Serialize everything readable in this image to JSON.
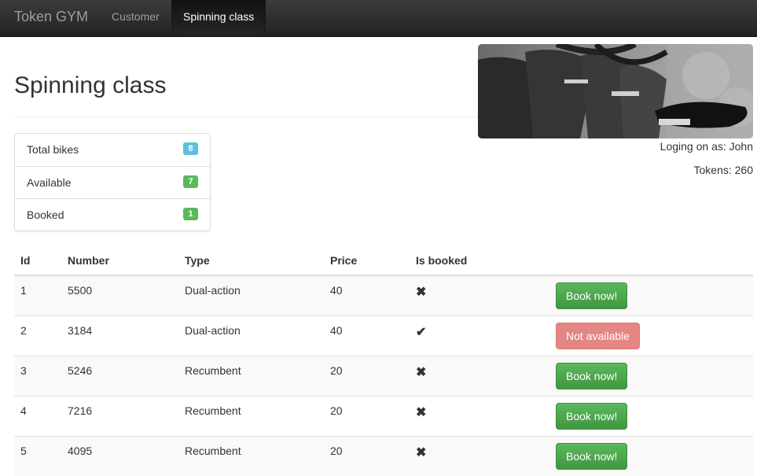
{
  "navbar": {
    "brand": "Token GYM",
    "items": [
      {
        "label": "Customer"
      },
      {
        "label": "Spinning class"
      }
    ]
  },
  "page": {
    "title": "Spinning class",
    "user_text": "Loging on as: John",
    "tokens_text": "Tokens: 260"
  },
  "stats": [
    {
      "label": "Total bikes",
      "count": "8",
      "color": "#5bc0de"
    },
    {
      "label": "Available",
      "count": "7",
      "color": "#5cb85c"
    },
    {
      "label": "Booked",
      "count": "1",
      "color": "#5cb85c"
    }
  ],
  "table": {
    "headers": [
      "Id",
      "Number",
      "Type",
      "Price",
      "Is booked"
    ],
    "rows": [
      {
        "id": "1",
        "number": "5500",
        "type": "Dual-action",
        "price": "40",
        "booked_icon": "cross-icon",
        "booked_glyph": "✖",
        "action": "Book now!"
      },
      {
        "id": "2",
        "number": "3184",
        "type": "Dual-action",
        "price": "40",
        "booked_icon": "check-icon",
        "booked_glyph": "✔",
        "action": "Not available"
      },
      {
        "id": "3",
        "number": "5246",
        "type": "Recumbent",
        "price": "20",
        "booked_icon": "cross-icon",
        "booked_glyph": "✖",
        "action": "Book now!"
      },
      {
        "id": "4",
        "number": "7216",
        "type": "Recumbent",
        "price": "20",
        "booked_icon": "cross-icon",
        "booked_glyph": "✖",
        "action": "Book now!"
      },
      {
        "id": "5",
        "number": "4095",
        "type": "Recumbent",
        "price": "20",
        "booked_icon": "cross-icon",
        "booked_glyph": "✖",
        "action": "Book now!"
      }
    ]
  },
  "colors": {
    "book_button": "#5cb85c",
    "unavailable_button": "#d9534f"
  }
}
